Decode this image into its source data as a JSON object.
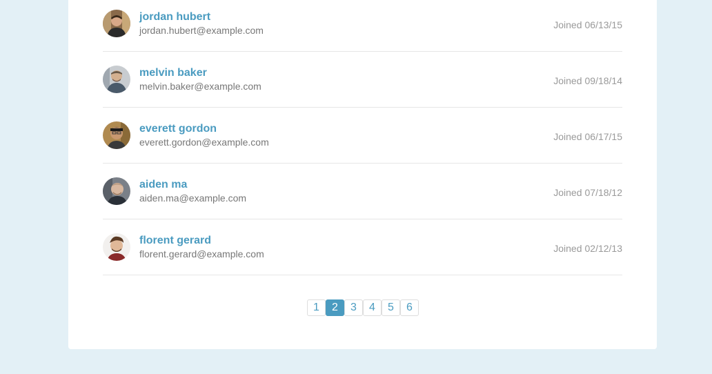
{
  "colors": {
    "page_background": "#e3f0f6",
    "card_background": "#ffffff",
    "accent": "#4a9bc0",
    "email_text": "#777777",
    "joined_text": "#999999"
  },
  "users": [
    {
      "name": "jordan hubert",
      "email": "jordan.hubert@example.com",
      "joined_label": "Joined",
      "joined_date": "06/13/15",
      "avatar": "user-avatar-photo"
    },
    {
      "name": "melvin baker",
      "email": "melvin.baker@example.com",
      "joined_label": "Joined",
      "joined_date": "09/18/14",
      "avatar": "user-avatar-photo"
    },
    {
      "name": "everett gordon",
      "email": "everett.gordon@example.com",
      "joined_label": "Joined",
      "joined_date": "06/17/15",
      "avatar": "user-avatar-photo"
    },
    {
      "name": "aiden ma",
      "email": "aiden.ma@example.com",
      "joined_label": "Joined",
      "joined_date": "07/18/12",
      "avatar": "user-avatar-photo"
    },
    {
      "name": "florent gerard",
      "email": "florent.gerard@example.com",
      "joined_label": "Joined",
      "joined_date": "02/12/13",
      "avatar": "user-avatar-photo"
    }
  ],
  "pagination": {
    "pages": [
      "1",
      "2",
      "3",
      "4",
      "5",
      "6"
    ],
    "current": "2"
  }
}
